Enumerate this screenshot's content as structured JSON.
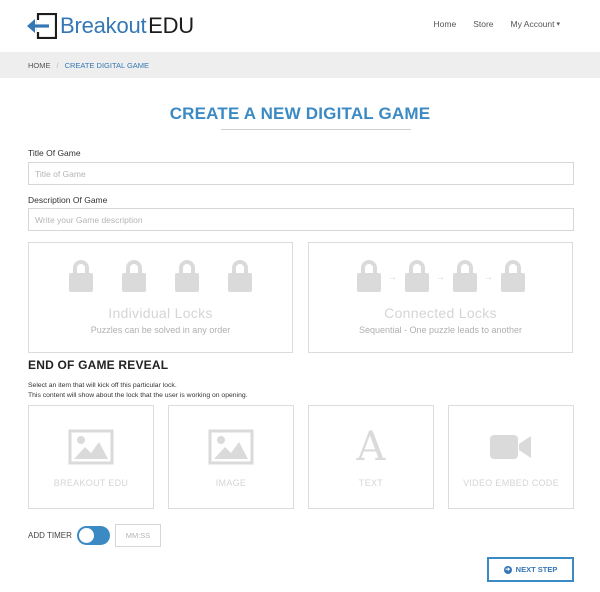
{
  "header": {
    "logo_brand": "Breakout",
    "logo_edu": "EDU",
    "nav": [
      "Home",
      "Store",
      "My Account"
    ]
  },
  "breadcrumb": {
    "home": "HOME",
    "separator": "/",
    "current": "CREATE DIGITAL GAME"
  },
  "page": {
    "title": "CREATE A NEW DIGITAL GAME"
  },
  "form": {
    "title_label": "Title Of Game",
    "title_placeholder": "Title of Game",
    "title_value": "",
    "description_label": "Description Of Game",
    "description_placeholder": "Write your Game description",
    "description_value": ""
  },
  "lock_types": [
    {
      "title": "Individual Locks",
      "subtitle": "Puzzles can be solved in any order",
      "icon": "lock-icon"
    },
    {
      "title": "Connected Locks",
      "subtitle": "Sequential - One puzzle leads to another",
      "icon": "lock-chain-icon"
    }
  ],
  "reveal": {
    "heading": "END OF GAME REVEAL",
    "desc_line1": "Select an item that will kick off this particular lock.",
    "desc_line2": "This content will show about the lock that the user is working on opening.",
    "options": [
      {
        "label": "BREAKOUT EDU",
        "icon": "image-icon"
      },
      {
        "label": "IMAGE",
        "icon": "image-icon"
      },
      {
        "label": "TEXT",
        "icon": "text-icon"
      },
      {
        "label": "VIDEO EMBED CODE",
        "icon": "video-camera-icon"
      }
    ]
  },
  "timer": {
    "label": "ADD TIMER",
    "enabled": true,
    "placeholder": "MM:SS",
    "value": ""
  },
  "actions": {
    "next_label": "NEXT STEP"
  },
  "colors": {
    "brand_blue": "#3577b5",
    "accent_blue": "#3c8ac4",
    "placeholder_gray": "#dadada"
  }
}
